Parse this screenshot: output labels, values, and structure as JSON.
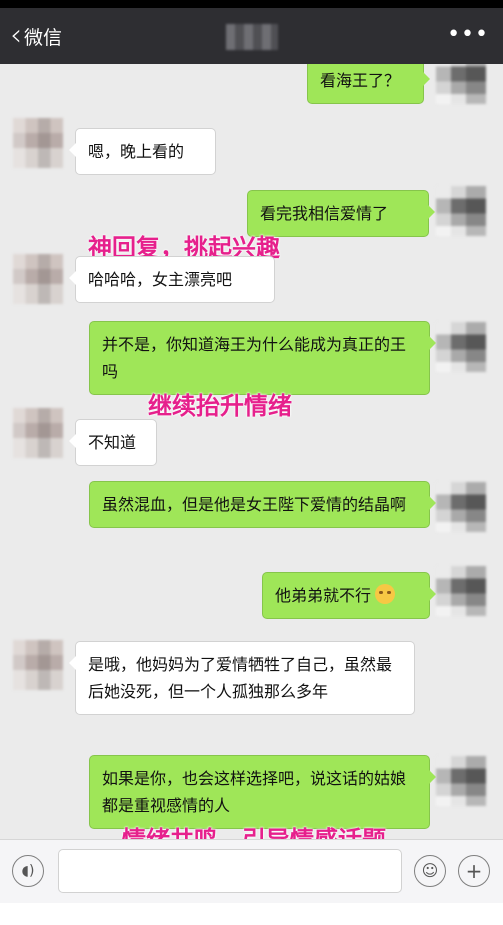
{
  "nav": {
    "back_label": "微信",
    "back_icon": "chevron-left-icon",
    "more_icon": "•••"
  },
  "messages": [
    {
      "side": "right",
      "text": "看海王了？"
    },
    {
      "side": "left",
      "text": "嗯，晚上看的"
    },
    {
      "side": "right",
      "text": "看完我相信爱情了"
    },
    {
      "side": "left",
      "text": "哈哈哈，女主漂亮吧"
    },
    {
      "side": "right",
      "text": "并不是，你知道海王为什么能成为真正的王吗"
    },
    {
      "side": "left",
      "text": "不知道"
    },
    {
      "side": "right",
      "text": "虽然混血，但是他是女王陛下爱情的结晶啊"
    },
    {
      "side": "right",
      "text": "他弟弟就不行",
      "emoji": "flushed-face"
    },
    {
      "side": "left",
      "text": "是哦，他妈妈为了爱情牺牲了自己，虽然最后她没死，但一个人孤独那么多年"
    },
    {
      "side": "right",
      "text": "如果是你，也会这样选择吧，说这话的姑娘都是重视感情的人"
    }
  ],
  "annotations": [
    "神回复，挑起兴趣",
    "继续抬升情绪",
    "情绪共鸣，引导情感话题"
  ],
  "input_bar": {
    "voice_icon": "voice-icon",
    "emoji_icon": "emoji-icon",
    "plus_icon": "plus-icon"
  },
  "colors": {
    "navbar": "#2e2e32",
    "right_bubble": "#9fe658",
    "left_bubble": "#ffffff",
    "background": "#ebebeb",
    "annotation": "#e6208c"
  }
}
